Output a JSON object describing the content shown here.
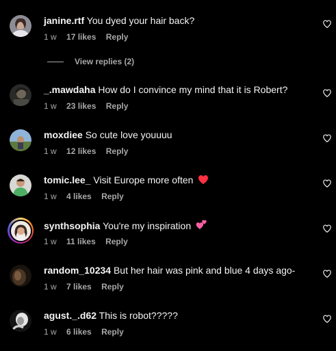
{
  "colors": {
    "background": "#000000",
    "text": "#f5f5f5",
    "muted": "#a8a8a8",
    "heart_red": "#ff3040",
    "heart_pink": "#ff5fa2"
  },
  "comments": [
    {
      "username": "janine.rtf",
      "text": "You dyed your hair back?",
      "time": "1 w",
      "likes": "17 likes",
      "reply": "Reply"
    },
    {
      "username": "_.mawdaha",
      "text": "How do I convince my mind that it is Robert?",
      "time": "1 w",
      "likes": "23 likes",
      "reply": "Reply"
    },
    {
      "username": "moxdiee",
      "text": "So cute love youuuu",
      "time": "1 w",
      "likes": "12 likes",
      "reply": "Reply"
    },
    {
      "username": "tomic.lee_",
      "text": "Visit Europe more often",
      "emoji": "red-heart",
      "time": "1 w",
      "likes": "4 likes",
      "reply": "Reply"
    },
    {
      "username": "synthsophia",
      "text": "You're my inspiration",
      "emoji": "two-hearts",
      "time": "1 w",
      "likes": "11 likes",
      "reply": "Reply"
    },
    {
      "username": "random_10234",
      "text": "But her hair was pink and blue 4 days ago-",
      "time": "1 w",
      "likes": "7 likes",
      "reply": "Reply"
    },
    {
      "username": "agust._.d62",
      "text": "This is robot?????",
      "time": "1 w",
      "likes": "6 likes",
      "reply": "Reply"
    }
  ],
  "view_replies": "View replies (2)",
  "icons": {
    "like": "heart-outline-icon"
  }
}
